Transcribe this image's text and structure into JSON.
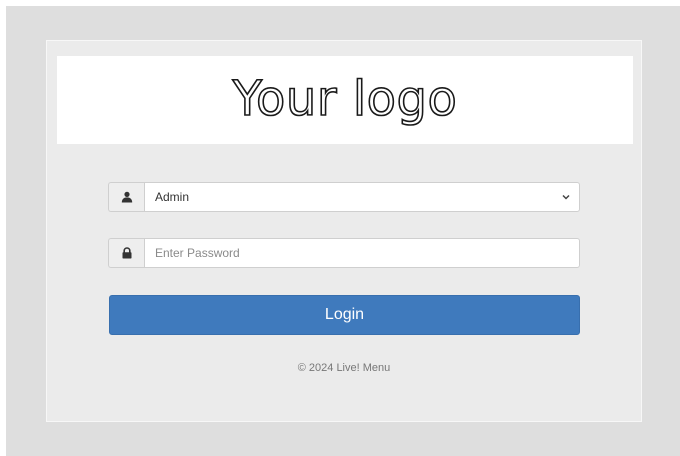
{
  "logo": {
    "text": "Your logo"
  },
  "user_field": {
    "icon": "user-icon",
    "selected_value": "Admin"
  },
  "password_field": {
    "icon": "lock-icon",
    "placeholder": "Enter Password",
    "value": ""
  },
  "login_button": {
    "label": "Login"
  },
  "footer": {
    "copyright": "© 2024 Live! Menu"
  },
  "colors": {
    "accent": "#3f7abd",
    "page_background": "#dedede",
    "card_background": "#ebebeb"
  }
}
